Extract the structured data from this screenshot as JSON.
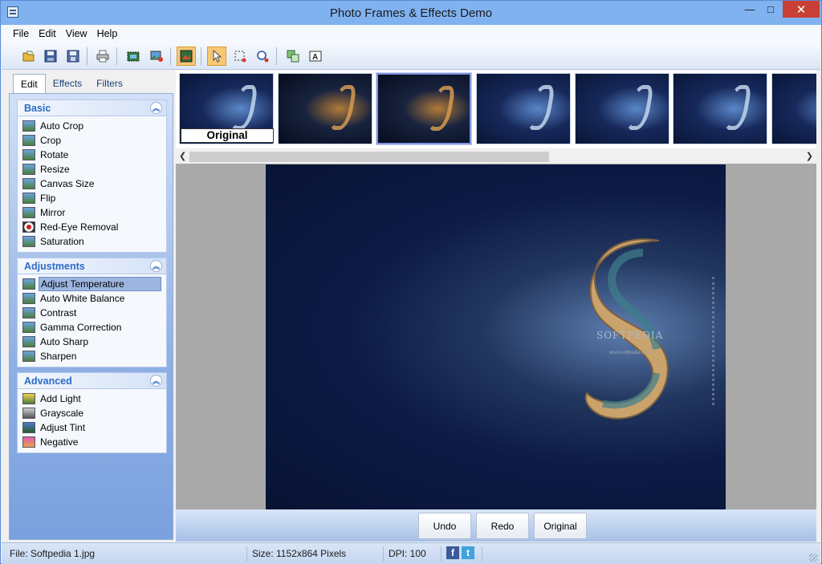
{
  "window": {
    "title": "Photo Frames & Effects Demo",
    "controls": {
      "minimize": "—",
      "maximize": "□",
      "close": "✕"
    }
  },
  "menu": [
    "File",
    "Edit",
    "View",
    "Help"
  ],
  "toolbar": [
    "open-folder-icon",
    "save-icon",
    "save-as-icon",
    "print-icon",
    "select-area-icon",
    "insert-image-icon",
    "photo-effect-icon",
    "pointer-icon",
    "rect-select-icon",
    "zoom-icon",
    "copy-icon",
    "text-icon"
  ],
  "left_panel": {
    "tabs": [
      "Edit",
      "Effects",
      "Filters"
    ],
    "groups": [
      {
        "title": "Basic",
        "items": [
          "Auto Crop",
          "Crop",
          "Rotate",
          "Resize",
          "Canvas Size",
          "Flip",
          "Mirror",
          "Red-Eye Removal",
          "Saturation"
        ]
      },
      {
        "title": "Adjustments",
        "items": [
          "Adjust Temperature",
          "Auto White Balance",
          "Contrast",
          "Gamma Correction",
          "Auto Sharp",
          "Sharpen"
        ],
        "selected": "Adjust Temperature"
      },
      {
        "title": "Advanced",
        "items": [
          "Add Light",
          "Grayscale",
          "Adjust Tint",
          "Negative"
        ]
      }
    ]
  },
  "thumbnails": {
    "original_label": "Original",
    "count": 7,
    "selected_index": 2
  },
  "image": {
    "watermark": "SOFTPEDIA",
    "watermark_url": "www.softpedia.com"
  },
  "actions": {
    "undo": "Undo",
    "redo": "Redo",
    "original": "Original"
  },
  "status": {
    "file": "File: Softpedia 1.jpg",
    "size": "Size: 1152x864 Pixels",
    "dpi": "DPI: 100"
  },
  "colors": {
    "titlebar": "#80b2f0",
    "close": "#c84035",
    "accent": "#2b6bc4"
  }
}
